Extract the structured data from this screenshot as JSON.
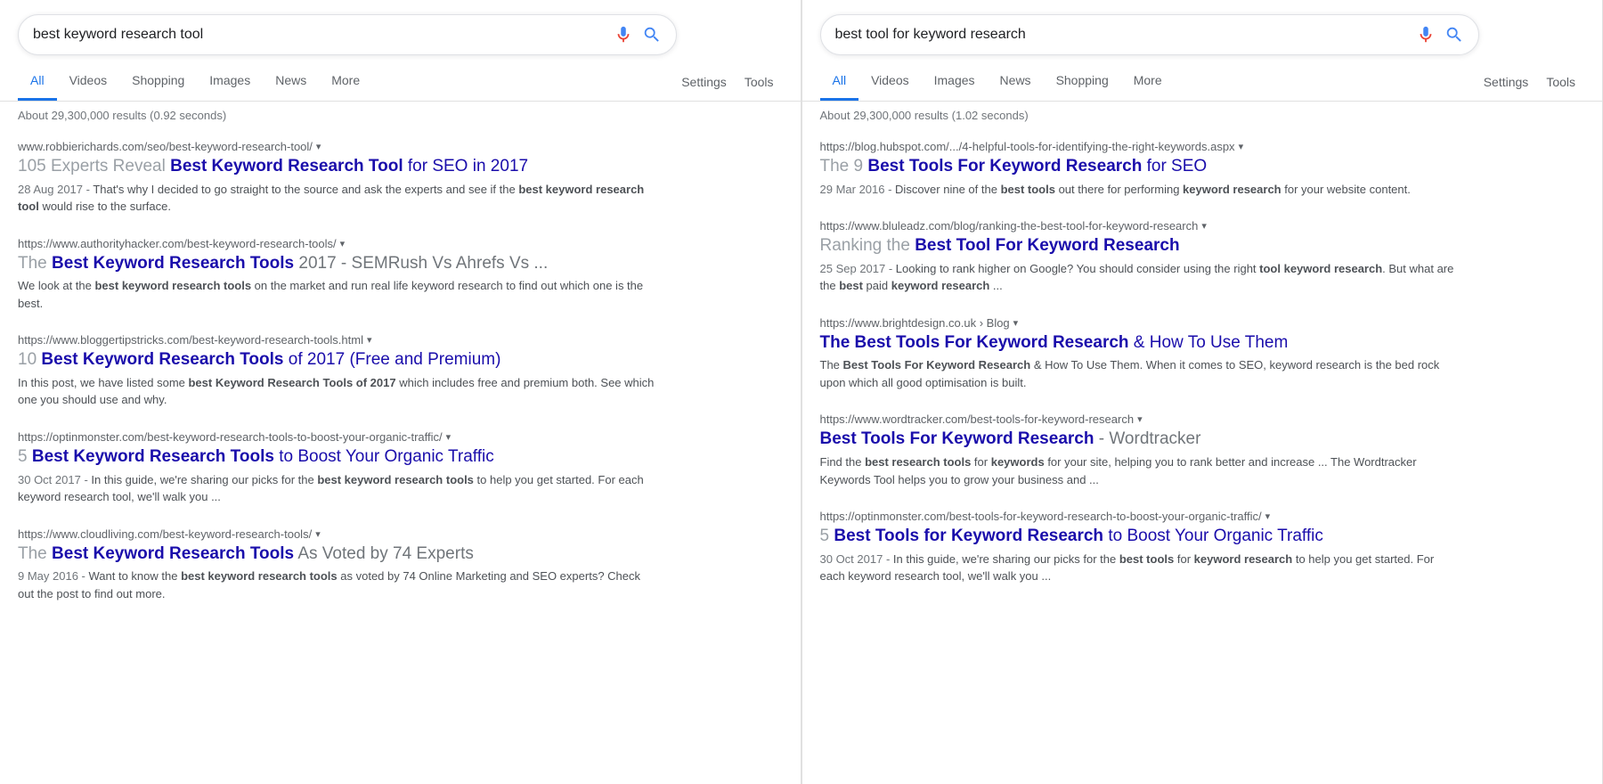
{
  "left": {
    "search": {
      "value": "best keyword research tool",
      "placeholder": "Search"
    },
    "tabs": [
      {
        "label": "All",
        "active": true
      },
      {
        "label": "Videos",
        "active": false
      },
      {
        "label": "Shopping",
        "active": false
      },
      {
        "label": "Images",
        "active": false
      },
      {
        "label": "News",
        "active": false
      },
      {
        "label": "More",
        "active": false
      }
    ],
    "settings_label": "Settings",
    "tools_label": "Tools",
    "results_info": "About 29,300,000 results (0.92 seconds)",
    "results": [
      {
        "title_parts": [
          {
            "text": "105 Experts Reveal ",
            "type": "normal"
          },
          {
            "text": "Best Keyword Research Tool",
            "type": "bold"
          },
          {
            "text": " for SEO in 2017",
            "type": "normal-dark"
          }
        ],
        "url": "www.robbierichards.com/seo/best-keyword-research-tool/",
        "date": "28 Aug 2017",
        "snippet": "That's why I decided to go straight to the source and ask the experts and see if the best keyword research tool would rise to the surface."
      },
      {
        "title_parts": [
          {
            "text": "The ",
            "type": "normal"
          },
          {
            "text": "Best Keyword Research Tools",
            "type": "bold"
          },
          {
            "text": " 2017 - SEMRush Vs Ahrefs Vs ...",
            "type": "normal-dark"
          }
        ],
        "url": "https://www.authorityhacker.com/best-keyword-research-tools/",
        "date": "",
        "snippet": "We look at the best keyword research tools on the market and run real life keyword research to find out which one is the best."
      },
      {
        "title_parts": [
          {
            "text": "10 ",
            "type": "normal"
          },
          {
            "text": "Best Keyword Research Tools",
            "type": "bold"
          },
          {
            "text": " of 2017 (Free and Premium)",
            "type": "normal-dark"
          }
        ],
        "url": "https://www.bloggertipstricks.com/best-keyword-research-tools.html",
        "date": "",
        "snippet": "In this post, we have listed some best Keyword Research Tools of 2017 which includes free and premium both. See which one you should use and why."
      },
      {
        "title_parts": [
          {
            "text": "5 ",
            "type": "normal"
          },
          {
            "text": "Best Keyword Research Tools",
            "type": "bold"
          },
          {
            "text": " to Boost Your Organic Traffic",
            "type": "normal-dark"
          }
        ],
        "url": "https://optinmonster.com/best-keyword-research-tools-to-boost-your-organic-traffic/",
        "date": "30 Oct 2017",
        "snippet": "In this guide, we're sharing our picks for the best keyword research tools to help you get started. For each keyword research tool, we'll walk you ..."
      },
      {
        "title_parts": [
          {
            "text": "The ",
            "type": "normal"
          },
          {
            "text": "Best Keyword Research Tools",
            "type": "bold"
          },
          {
            "text": " As Voted by 74 Experts",
            "type": "normal-dark"
          }
        ],
        "url": "https://www.cloudliving.com/best-keyword-research-tools/",
        "date": "9 May 2016",
        "snippet": "Want to know the best keyword research tools as voted by 74 Online Marketing and SEO experts? Check out the post to find out more."
      }
    ]
  },
  "right": {
    "search": {
      "value": "best tool for keyword research",
      "placeholder": "Search"
    },
    "tabs": [
      {
        "label": "All",
        "active": true
      },
      {
        "label": "Videos",
        "active": false
      },
      {
        "label": "Images",
        "active": false
      },
      {
        "label": "News",
        "active": false
      },
      {
        "label": "Shopping",
        "active": false
      },
      {
        "label": "More",
        "active": false
      }
    ],
    "settings_label": "Settings",
    "tools_label": "Tools",
    "results_info": "About 29,300,000 results (1.02 seconds)",
    "results": [
      {
        "title_parts": [
          {
            "text": "The 9 ",
            "type": "normal"
          },
          {
            "text": "Best Tools For Keyword Research",
            "type": "bold"
          },
          {
            "text": " for SEO",
            "type": "normal-dark"
          }
        ],
        "url": "https://blog.hubspot.com/.../4-helpful-tools-for-identifying-the-right-keywords.aspx",
        "date": "29 Mar 2016",
        "snippet": "Discover nine of the best tools out there for performing keyword research for your website content."
      },
      {
        "title_parts": [
          {
            "text": "Ranking the ",
            "type": "normal"
          },
          {
            "text": "Best Tool For Keyword Research",
            "type": "bold"
          },
          {
            "text": "",
            "type": ""
          }
        ],
        "url": "https://www.bluleadz.com/blog/ranking-the-best-tool-for-keyword-research",
        "date": "25 Sep 2017",
        "snippet": "Looking to rank higher on Google? You should consider using the right tool keyword research. But what are the best paid keyword research ..."
      },
      {
        "title_parts": [
          {
            "text": "The Best Tools For Keyword Research",
            "type": "bold"
          },
          {
            "text": " & How To Use Them",
            "type": "normal-dark"
          }
        ],
        "url": "https://www.brightdesign.co.uk › Blog",
        "date": "",
        "snippet": "The Best Tools For Keyword Research & How To Use Them. When it comes to SEO, keyword research is the bed rock upon which all good optimisation is built."
      },
      {
        "title_parts": [
          {
            "text": "Best Tools For Keyword Research",
            "type": "bold"
          },
          {
            "text": " - Wordtracker",
            "type": "normal-dark"
          }
        ],
        "url": "https://www.wordtracker.com/best-tools-for-keyword-research",
        "date": "",
        "snippet": "Find the best research tools for keywords for your site, helping you to rank better and increase ... The Wordtracker Keywords Tool helps you to grow your business and ..."
      },
      {
        "title_parts": [
          {
            "text": "5 ",
            "type": "normal"
          },
          {
            "text": "Best Tools for Keyword Research",
            "type": "bold"
          },
          {
            "text": " to Boost Your Organic Traffic",
            "type": "normal-dark"
          }
        ],
        "url": "https://optinmonster.com/best-tools-for-keyword-research-to-boost-your-organic-traffic/",
        "date": "30 Oct 2017",
        "snippet": "In this guide, we're sharing our picks for the best tools for keyword research to help you get started. For each keyword research tool, we'll walk you ..."
      }
    ]
  },
  "colors": {
    "active_tab": "#1a73e8",
    "link_title": "#1a0dab",
    "link_normal": "#9aa0a6",
    "url_color": "#5f6368",
    "snippet_color": "#4d5156",
    "date_color": "#70757a"
  }
}
